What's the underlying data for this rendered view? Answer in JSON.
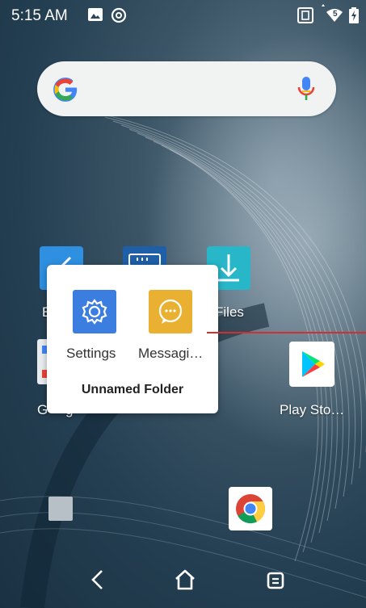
{
  "status_bar": {
    "time": "5:15 AM",
    "left_icons": [
      "image-icon",
      "at-icon"
    ],
    "right_icons": [
      "nfc-icon",
      "wifi-icon",
      "battery-icon"
    ],
    "wifi_label": "5"
  },
  "search_bar": {
    "logo_icon": "google-g-icon",
    "mic_icon": "mic-icon"
  },
  "home_apps": [
    {
      "label": "",
      "icon": "blue-app-icon"
    },
    {
      "label": "",
      "icon": "keyboard-app-icon"
    },
    {
      "label": "Files",
      "icon": "download-icon"
    },
    {
      "label": "Play Sto…",
      "icon": "play-store-icon"
    },
    {
      "label": "",
      "icon": "square-placeholder-icon"
    },
    {
      "label": "",
      "icon": "chrome-icon"
    }
  ],
  "partially_hidden_labels": {
    "left_top": "E",
    "left_bottom": "G",
    "left_bottom_tail": "g"
  },
  "folder_popup": {
    "apps": [
      {
        "label": "Settings",
        "icon": "settings-gear-icon"
      },
      {
        "label": "Messagi…",
        "icon": "chat-bubble-icon"
      }
    ],
    "name": "Unnamed Folder"
  },
  "nav_bar": {
    "buttons": [
      "back-icon",
      "home-icon",
      "recents-icon"
    ]
  },
  "colors": {
    "red_line": "#d32f2f",
    "settings_bg": "#3b7ee0",
    "messaging_bg": "#e9b031",
    "files_bg": "#28b6c9"
  }
}
